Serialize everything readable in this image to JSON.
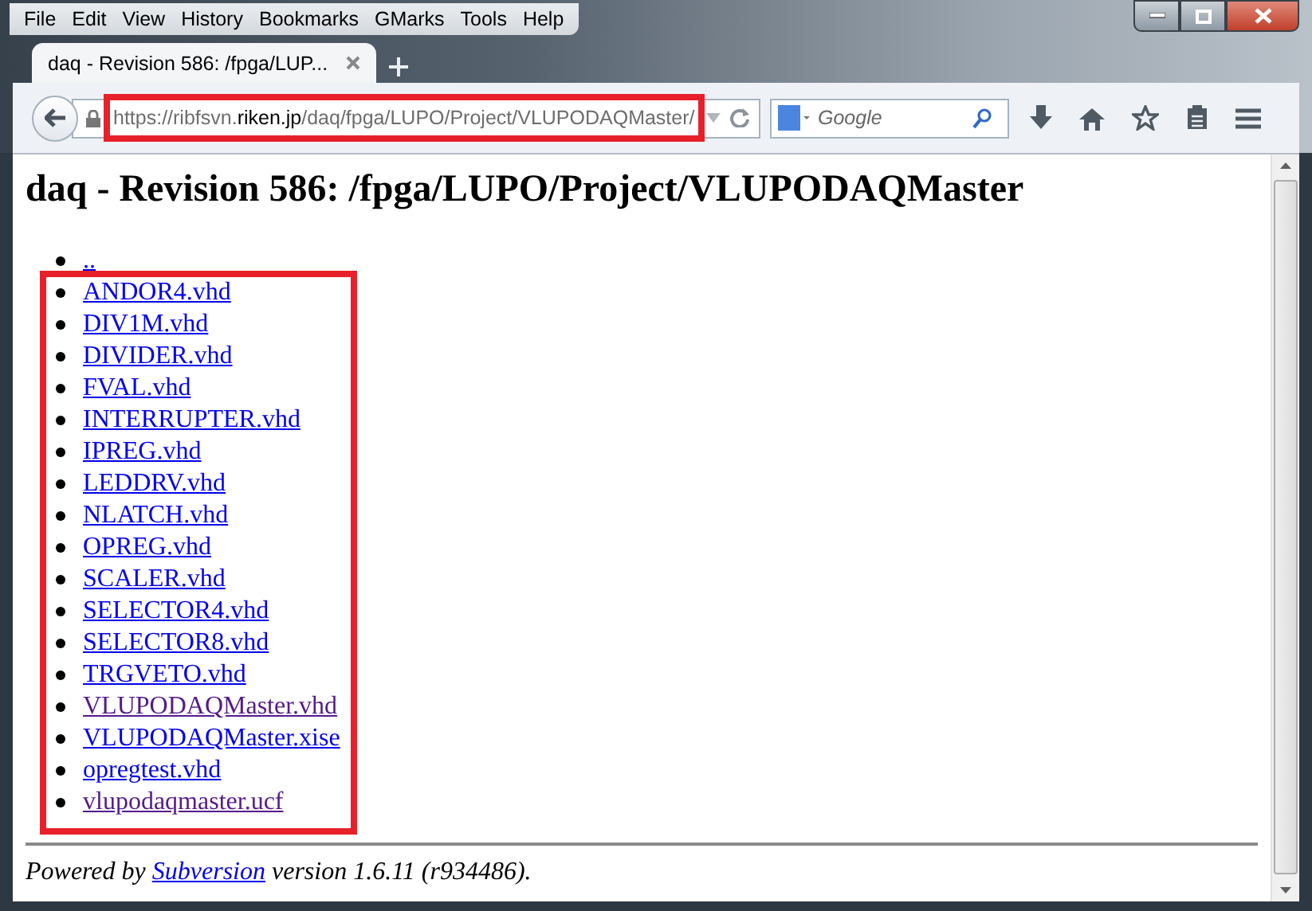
{
  "menu": [
    "File",
    "Edit",
    "View",
    "History",
    "Bookmarks",
    "GMarks",
    "Tools",
    "Help"
  ],
  "tabs": [
    {
      "title": "daq - Revision 586: /fpga/LUP...",
      "selected": true
    }
  ],
  "address_bar": {
    "highlighted": true,
    "url_parts": [
      {
        "text": "https://ribfsvn.",
        "emphasis": false
      },
      {
        "text": "riken.jp",
        "emphasis": true
      },
      {
        "text": "/daq/fpga/LUPO/Project/VLUPODAQMaster/",
        "emphasis": false
      }
    ]
  },
  "search": {
    "placeholder": "Google"
  },
  "page": {
    "heading": "daq - Revision 586: /fpga/LUPO/Project/VLUPODAQMaster",
    "parent": {
      "name": "..",
      "visited": false
    },
    "files_highlighted": true,
    "files": [
      {
        "name": "ANDOR4.vhd",
        "visited": false
      },
      {
        "name": "DIV1M.vhd",
        "visited": false
      },
      {
        "name": "DIVIDER.vhd",
        "visited": false
      },
      {
        "name": "FVAL.vhd",
        "visited": false
      },
      {
        "name": "INTERRUPTER.vhd",
        "visited": false
      },
      {
        "name": "IPREG.vhd",
        "visited": false
      },
      {
        "name": "LEDDRV.vhd",
        "visited": false
      },
      {
        "name": "NLATCH.vhd",
        "visited": false
      },
      {
        "name": "OPREG.vhd",
        "visited": false
      },
      {
        "name": "SCALER.vhd",
        "visited": false
      },
      {
        "name": "SELECTOR4.vhd",
        "visited": false
      },
      {
        "name": "SELECTOR8.vhd",
        "visited": false
      },
      {
        "name": "TRGVETO.vhd",
        "visited": false
      },
      {
        "name": "VLUPODAQMaster.vhd",
        "visited": true
      },
      {
        "name": "VLUPODAQMaster.xise",
        "visited": false
      },
      {
        "name": "opregtest.vhd",
        "visited": false
      },
      {
        "name": "vlupodaqmaster.ucf",
        "visited": true
      }
    ],
    "footer": {
      "before": "Powered by ",
      "link": "Subversion",
      "after": " version 1.6.11 (r934486)."
    }
  }
}
